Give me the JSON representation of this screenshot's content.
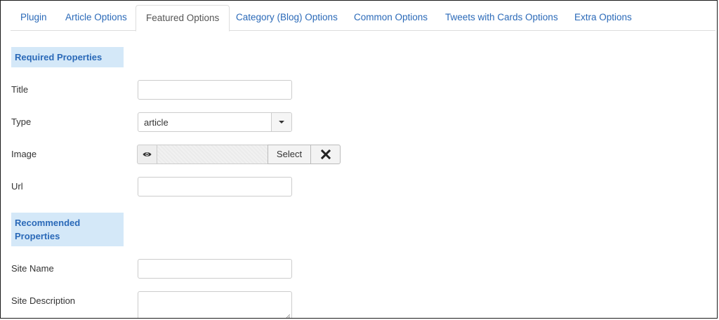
{
  "tabs": [
    {
      "label": "Plugin",
      "active": false
    },
    {
      "label": "Article Options",
      "active": false
    },
    {
      "label": "Featured Options",
      "active": true
    },
    {
      "label": "Category (Blog) Options",
      "active": false
    },
    {
      "label": "Common Options",
      "active": false
    },
    {
      "label": "Tweets with Cards Options",
      "active": false
    },
    {
      "label": "Extra Options",
      "active": false
    }
  ],
  "sections": {
    "required": "Required Properties",
    "recommended_line1": "Recommended",
    "recommended_line2": "Properties"
  },
  "fields": {
    "title": {
      "label": "Title",
      "value": ""
    },
    "type": {
      "label": "Type",
      "value": "article"
    },
    "image": {
      "label": "Image",
      "select_label": "Select",
      "preview_icon": "eye-icon",
      "clear_icon": "close-icon"
    },
    "url": {
      "label": "Url",
      "value": ""
    },
    "site_name": {
      "label": "Site Name",
      "value": ""
    },
    "site_description": {
      "label": "Site Description",
      "value": ""
    }
  },
  "colors": {
    "link": "#2a69b8",
    "section_bg": "#d4e8f8"
  }
}
